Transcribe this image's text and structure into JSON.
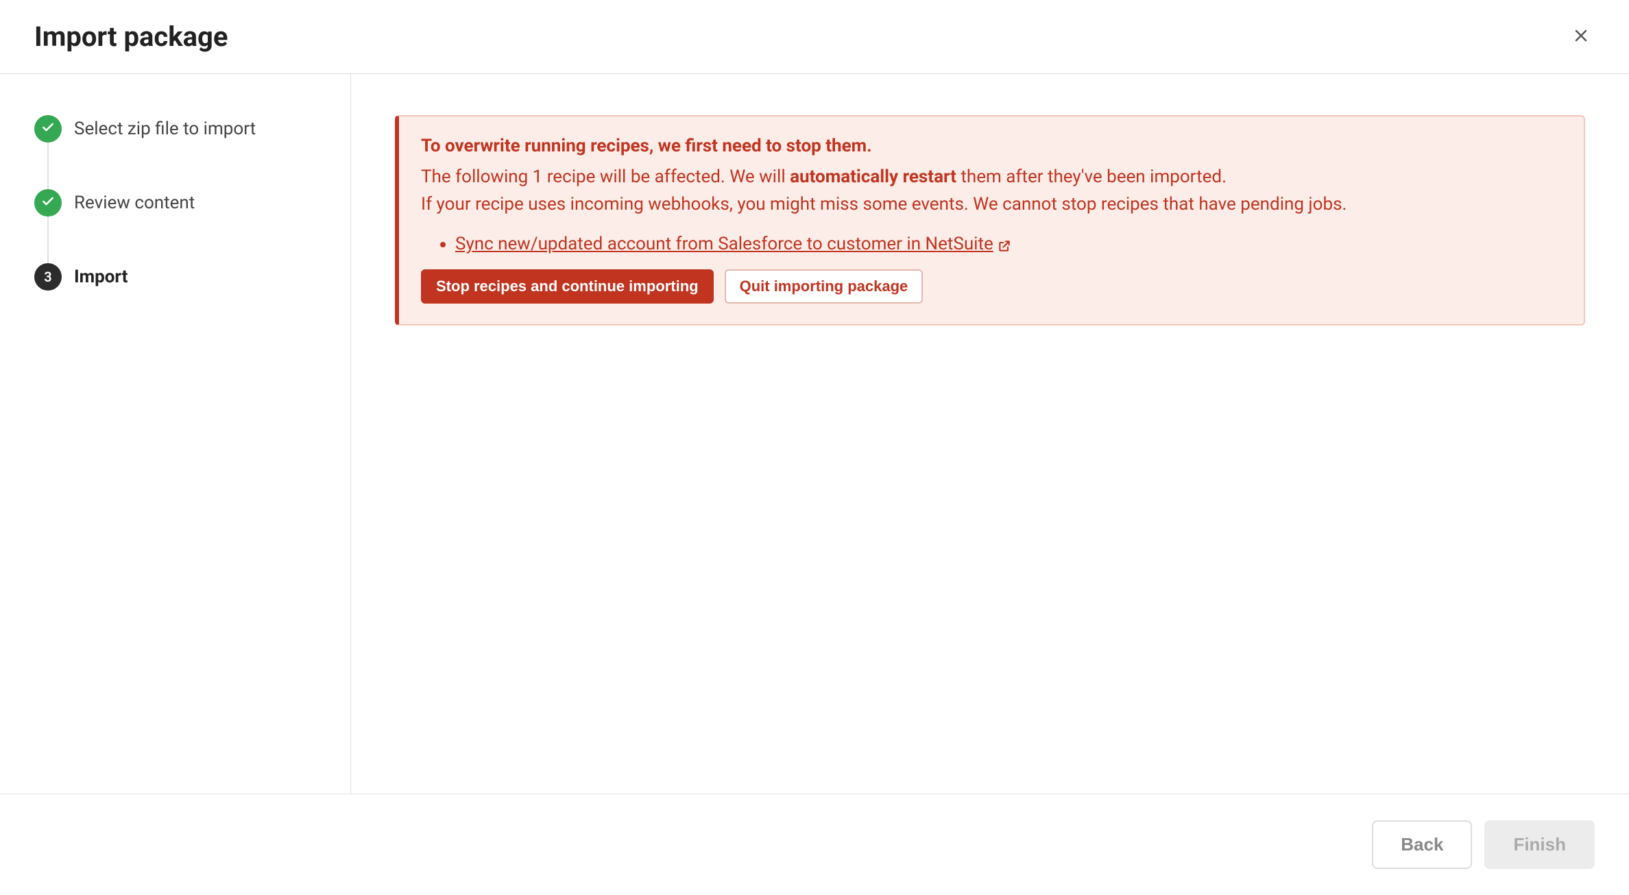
{
  "header": {
    "title": "Import package"
  },
  "steps": {
    "step1": "Select zip file to import",
    "step2": "Review content",
    "step3_num": "3",
    "step3": "Import"
  },
  "alert": {
    "title": "To overwrite running recipes, we first need to stop them.",
    "line1_a": "The following 1 recipe will be affected. We will ",
    "line1_bold": "automatically restart",
    "line1_b": " them after they've been imported.",
    "line2": "If your recipe uses incoming webhooks, you might miss some events. We cannot stop recipes that have pending jobs.",
    "recipe_link": "Sync new/updated account from Salesforce to customer in NetSuite",
    "btn_continue": "Stop recipes and continue importing",
    "btn_quit": "Quit importing package"
  },
  "footer": {
    "back": "Back",
    "finish": "Finish"
  }
}
